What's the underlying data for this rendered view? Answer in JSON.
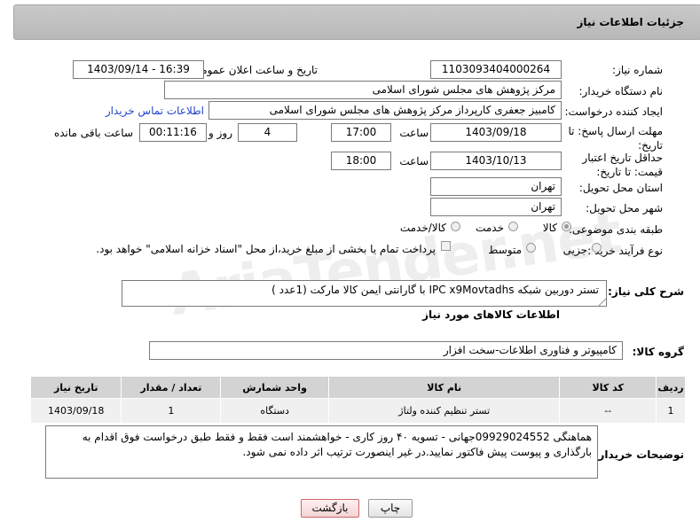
{
  "header": {
    "title": "جزئیات اطلاعات نیاز"
  },
  "watermark": {
    "text": "AriaTender.net"
  },
  "fields": {
    "need_number_label": "شماره نیاز:",
    "need_number": "1103093404000264",
    "announce_label": "تاریخ و ساعت اعلان عمومی:",
    "announce_value": "1403/09/14 - 16:39",
    "buyer_label": "نام دستگاه خریدار:",
    "buyer": "مرکز پژوهش های مجلس شورای اسلامی",
    "creator_label": "ایجاد کننده درخواست:",
    "creator": "کامبیز جعفری کارپرداز مرکز پژوهش های مجلس شورای اسلامی",
    "contact_link": "اطلاعات تماس خریدار",
    "deadline_label": "مهلت ارسال پاسخ: تا تاریخ:",
    "deadline_date": "1403/09/18",
    "time_label": "ساعت",
    "deadline_time": "17:00",
    "days_value": "4",
    "days_label": "روز و",
    "remaining_time": "00:11:16",
    "remaining_label": "ساعت باقی مانده",
    "validity_label": "حداقل تاریخ اعتبار قیمت: تا تاریخ:",
    "validity_date": "1403/10/13",
    "validity_time": "18:00",
    "province_label": "استان محل تحویل:",
    "province": "تهران",
    "city_label": "شهر محل تحویل:",
    "city": "تهران",
    "category_label": "طبقه بندی موضوعی:",
    "category_options": [
      "کالا",
      "خدمت",
      "کالا/خدمت"
    ],
    "process_label": "نوع فرآیند خرید :",
    "process_options": [
      "جزیی",
      "متوسط"
    ],
    "payment_note": "پرداخت تمام یا بخشی از مبلغ خرید،از محل \"اسناد خزانه اسلامی\" خواهد بود."
  },
  "description": {
    "label": "شرح کلی نیاز:",
    "text": "تستر دوربین شبکه IPC x9Movtadhs با گارانتی ایمن کالا مارکت (1عدد )"
  },
  "goods_section": {
    "title": "اطلاعات کالاهای مورد نیاز",
    "group_label": "گروه کالا:",
    "group_value": "کامپیوتر و فناوری اطلاعات-سخت افزار"
  },
  "table": {
    "headers": [
      "ردیف",
      "کد کالا",
      "نام کالا",
      "واحد شمارش",
      "تعداد / مقدار",
      "تاریخ نیاز"
    ],
    "rows": [
      [
        "1",
        "--",
        "تستر تنظیم کننده ولتاژ",
        "دستگاه",
        "1",
        "1403/09/18"
      ]
    ]
  },
  "buyer_notes": {
    "label": "توضیحات خریدار:",
    "text": "هماهنگی 09929024552جهانی - تسویه ۴۰ روز کاری - خواهشمند است فقط و فقط طبق درخواست فوق اقدام به بارگذاری و پیوست پیش فاکتور نمایید.در غیر اینصورت ترتیب اثر داده نمی شود."
  },
  "buttons": {
    "print": "چاپ",
    "back": "بازگشت"
  }
}
